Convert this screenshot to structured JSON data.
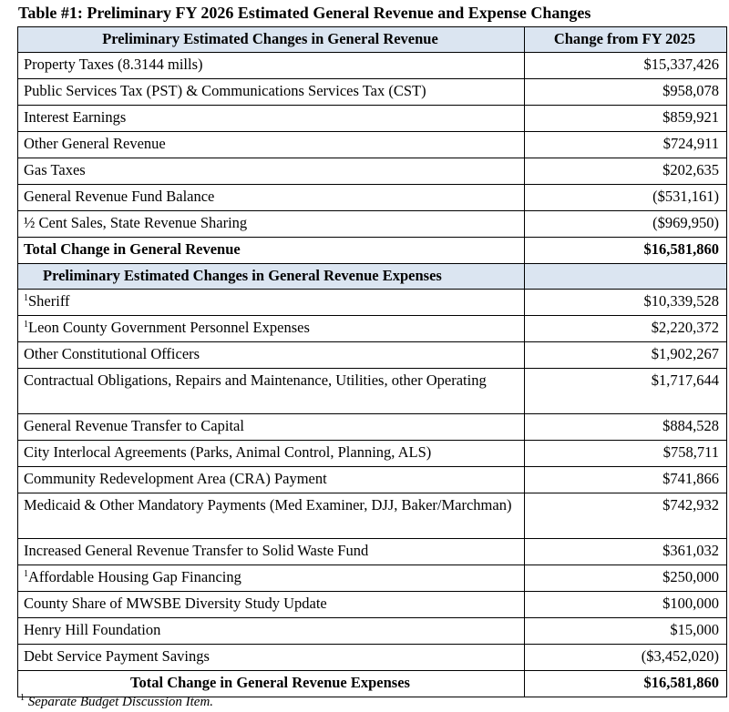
{
  "caption": "Table #1:  Preliminary FY 2026 Estimated General Revenue and Expense Changes",
  "revenue": {
    "header": "Preliminary Estimated Changes in General Revenue",
    "change_header": "Change from FY 2025",
    "rows": [
      {
        "label": "Property Taxes (8.3144 mills)",
        "value": "$15,337,426"
      },
      {
        "label": "Public Services Tax (PST) & Communications Services Tax (CST)",
        "value": "$958,078"
      },
      {
        "label": "Interest Earnings",
        "value": "$859,921"
      },
      {
        "label": "Other General Revenue",
        "value": "$724,911"
      },
      {
        "label": "Gas Taxes",
        "value": "$202,635"
      },
      {
        "label": "General Revenue Fund Balance",
        "value": "($531,161)"
      },
      {
        "label": "½ Cent Sales, State Revenue Sharing",
        "value": "($969,950)"
      }
    ],
    "total_label": "Total Change in General Revenue",
    "total_value": "$16,581,860"
  },
  "expenses": {
    "header": "Preliminary Estimated Changes in General Revenue Expenses",
    "footnote_mark": "1",
    "rows": [
      {
        "label": "Sheriff",
        "value": "$10,339,528"
      },
      {
        "label": "Leon County Government Personnel Expenses",
        "value": "$2,220,372"
      },
      {
        "label": "Other Constitutional Officers",
        "value": "$1,902,267"
      },
      {
        "label": "Contractual Obligations, Repairs and Maintenance, Utilities, other Operating",
        "value": "$1,717,644"
      },
      {
        "label": "General Revenue Transfer to Capital",
        "value": "$884,528"
      },
      {
        "label": "City Interlocal Agreements (Parks, Animal Control, Planning, ALS)",
        "value": "$758,711"
      },
      {
        "label": "Community Redevelopment Area (CRA) Payment",
        "value": "$741,866"
      },
      {
        "label": "Medicaid & Other Mandatory Payments (Med Examiner, DJJ, Baker/Marchman)",
        "value": "$742,932"
      },
      {
        "label": "Increased General Revenue Transfer to Solid Waste Fund",
        "value": "$361,032"
      },
      {
        "label": "Affordable Housing Gap Financing",
        "value": "$250,000"
      },
      {
        "label": "County Share of MWSBE Diversity Study Update",
        "value": "$100,000"
      },
      {
        "label": "Henry Hill Foundation",
        "value": "$15,000"
      },
      {
        "label": "Debt Service Payment Savings",
        "value": "($3,452,020)"
      }
    ],
    "total_label": "Total Change in General Revenue Expenses",
    "total_value": "$16,581,860"
  },
  "footnote": {
    "mark": "1",
    "text": "Separate Budget Discussion Item."
  }
}
